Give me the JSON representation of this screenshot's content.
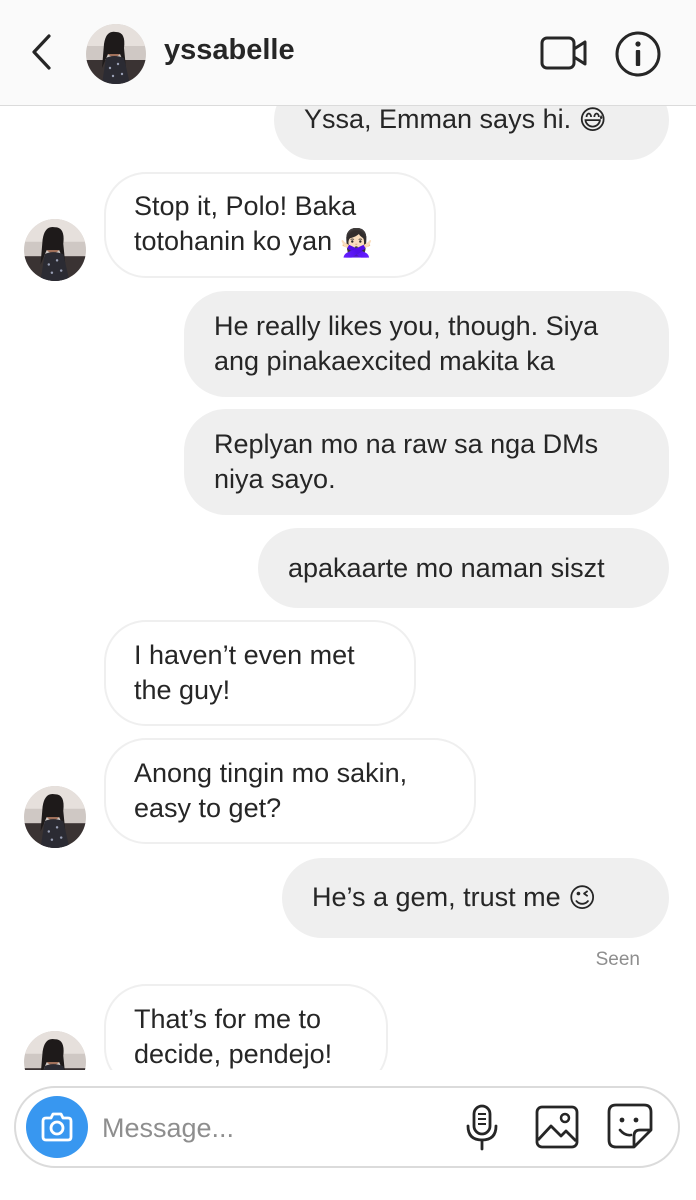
{
  "header": {
    "username": "yssabelle",
    "icons": {
      "back": "chevron-left-icon",
      "video": "video-camera-icon",
      "info": "info-icon"
    }
  },
  "thread": {
    "messages": [
      {
        "from": "me",
        "lines": [
          "Yssa, Emman says hi."
        ],
        "emoji": "😅"
      },
      {
        "from": "them",
        "lines": [
          "Stop it, Polo! Baka",
          "totohanin ko yan"
        ],
        "emoji": "🙅🏻‍♀️"
      },
      {
        "from": "me",
        "lines": [
          "He really likes you, though. Siya",
          "ang pinakaexcited makita ka"
        ]
      },
      {
        "from": "me",
        "lines": [
          "Replyan mo na raw sa nga DMs",
          "niya sayo."
        ]
      },
      {
        "from": "me",
        "lines": [
          "apakaarte mo naman siszt"
        ]
      },
      {
        "from": "them",
        "lines": [
          "I haven’t even met",
          "the guy!"
        ]
      },
      {
        "from": "them",
        "lines": [
          "Anong tingin mo sakin,",
          "easy to get?"
        ]
      },
      {
        "from": "me",
        "lines": [
          "He’s a gem, trust me"
        ],
        "emoji": "😉"
      },
      {
        "from": "them",
        "lines": [
          "That’s for me to",
          "decide, pendejo!"
        ]
      }
    ],
    "seen_label": "Seen"
  },
  "composer": {
    "placeholder": "Message...",
    "icons": {
      "camera": "camera-icon",
      "mic": "microphone-icon",
      "gallery": "gallery-icon",
      "sticker": "sticker-icon"
    }
  },
  "colors": {
    "accent": "#3897f0",
    "bubble_out": "#efefef",
    "bubble_in_border": "#efefef",
    "muted_text": "#8e8e8e"
  }
}
